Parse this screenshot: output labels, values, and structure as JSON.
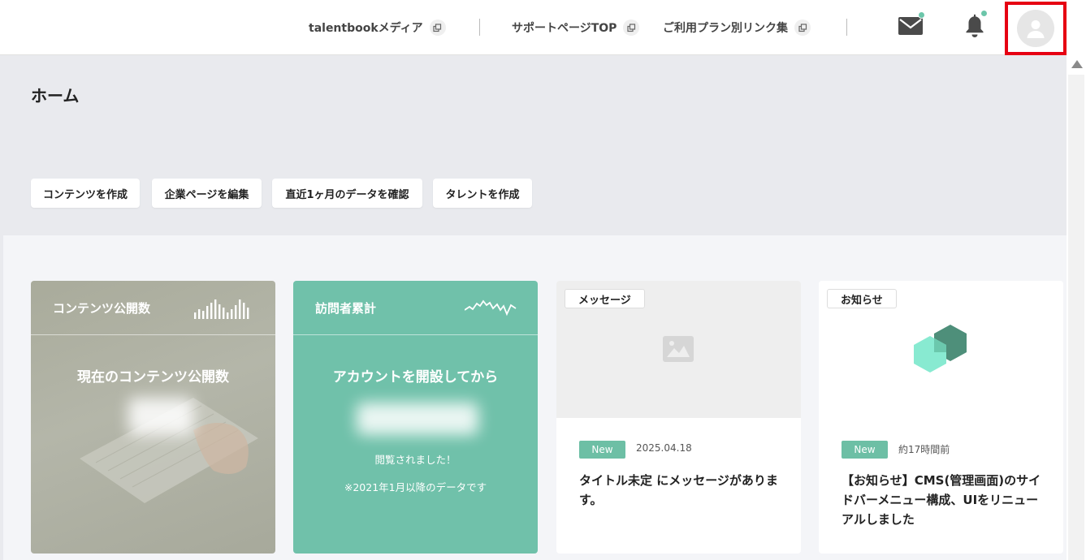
{
  "topbar": {
    "links": [
      {
        "label": "talentbookメディア"
      },
      {
        "label": "サポートページTOP"
      },
      {
        "label": "ご利用プラン別リンク集"
      }
    ],
    "icons": {
      "mail": "mail-icon",
      "bell": "bell-icon",
      "user": "user-icon",
      "external": "external-link-icon"
    },
    "accent": "#6cc6aa",
    "highlight": "#e60012"
  },
  "page": {
    "title": "ホーム",
    "quick_actions": [
      {
        "label": "コンテンツを作成"
      },
      {
        "label": "企業ページを編集"
      },
      {
        "label": "直近1ヶ月のデータを確認"
      },
      {
        "label": "タレントを作成"
      }
    ]
  },
  "cards": {
    "content_count": {
      "title": "コンテンツ公開数",
      "heading": "現在のコンテンツ公開数"
    },
    "visitors": {
      "title": "訪問者累計",
      "heading": "アカウントを開設してから",
      "line1": "閲覧されました！",
      "line2": "※2021年1月以降のデータです"
    },
    "message": {
      "badge": "メッセージ",
      "tag": "New",
      "date": "2025.04.18",
      "title": "タイトル未定 にメッセージがあります。"
    },
    "notice": {
      "badge": "お知らせ",
      "tag": "New",
      "date": "約17時間前",
      "title": "【お知らせ】CMS(管理画面)のサイドバーメニュー構成、UIをリニューアルしました"
    }
  }
}
